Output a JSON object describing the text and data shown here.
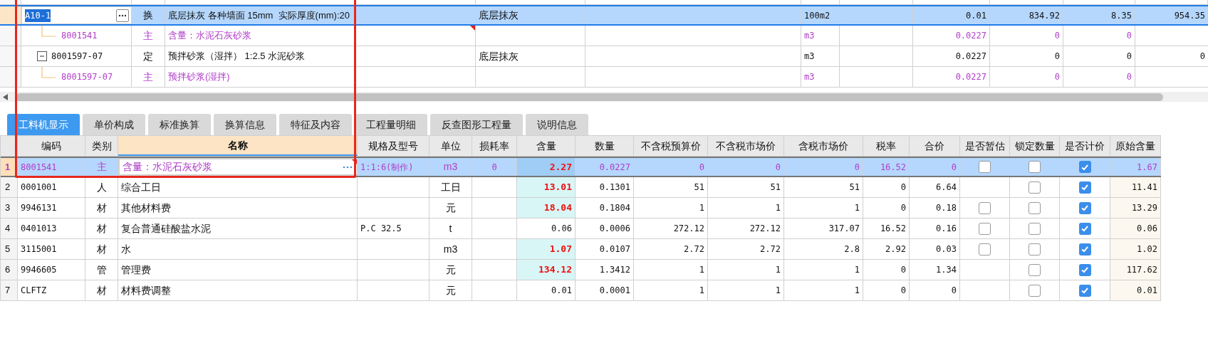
{
  "top_grid": {
    "rows": [
      {
        "code": "A10-1",
        "type": "换",
        "name": "底层抹灰 各种墙面 15mm  实际厚度(mm):20",
        "column_4": "底层抹灰",
        "unit": "100m2",
        "column_8": "0.01",
        "column_9": "834.92",
        "column_10": "8.35",
        "column_11": "954.35",
        "selected": true,
        "kind": "item",
        "editing": true,
        "children": [
          {
            "code": "8001541",
            "type": "主",
            "name": "含量：水泥石灰砂浆",
            "unit": "m3",
            "column_8": "0.0227",
            "column_9": "0",
            "column_10": "0",
            "selected": false,
            "kind": "resource",
            "flagged": true
          },
          {
            "code": "8001597-07",
            "type": "定",
            "name": "预拌砂浆（湿拌） 1:2.5 水泥砂浆",
            "column_4": "底层抹灰",
            "unit": "m3",
            "column_8": "0.0227",
            "column_9": "0",
            "column_10": "0",
            "column_11": "0",
            "selected": false,
            "kind": "item",
            "expanded": true,
            "children": [
              {
                "code": "8001597-07",
                "type": "主",
                "name": "预拌砂浆(湿拌)",
                "unit": "m3",
                "column_8": "0.0227",
                "column_9": "0",
                "column_10": "0",
                "selected": false,
                "kind": "resource"
              }
            ]
          }
        ]
      }
    ]
  },
  "tabs": [
    {
      "label": "工料机显示",
      "selected": true
    },
    {
      "label": "单价构成",
      "selected": false
    },
    {
      "label": "标准换算",
      "selected": false
    },
    {
      "label": "换算信息",
      "selected": false
    },
    {
      "label": "特征及内容",
      "selected": false
    },
    {
      "label": "工程量明细",
      "selected": false
    },
    {
      "label": "反查图形工程量",
      "selected": false
    },
    {
      "label": "说明信息",
      "selected": false
    }
  ],
  "detail_table": {
    "columns": [
      {
        "label": "编码",
        "selected": false
      },
      {
        "label": "类别",
        "selected": false
      },
      {
        "label": "名称",
        "selected": true
      },
      {
        "label": "规格及型号",
        "selected": false
      },
      {
        "label": "单位",
        "selected": false
      },
      {
        "label": "损耗率",
        "selected": false
      },
      {
        "label": "含量",
        "selected": false
      },
      {
        "label": "数量",
        "selected": false
      },
      {
        "label": "不含税预算价",
        "selected": false
      },
      {
        "label": "不含税市场价",
        "selected": false
      },
      {
        "label": "含税市场价",
        "selected": false
      },
      {
        "label": "税率",
        "selected": false
      },
      {
        "label": "合价",
        "selected": false
      },
      {
        "label": "是否暂估",
        "selected": false
      },
      {
        "label": "锁定数量",
        "selected": false
      },
      {
        "label": "是否计价",
        "selected": false
      },
      {
        "label": "原始含量",
        "selected": false
      }
    ],
    "rows": [
      {
        "number": "1",
        "code": "8001541",
        "type": "主",
        "name": "含量：水泥石灰砂浆",
        "spec": "1:1:6(制作)",
        "unit": "m3",
        "loss": "0",
        "content": "2.27",
        "quantity": "0.0227",
        "budget_price_ex_tax": "0",
        "market_price_ex_tax": "0",
        "market_price_inc_tax": "0",
        "tax_rate": "16.52",
        "total": "0",
        "provisional": false,
        "locked": false,
        "counted": true,
        "original_content": "1.67",
        "selected": true,
        "kind": "resource",
        "content_changed": true,
        "flagged": true,
        "editing": true
      },
      {
        "number": "2",
        "code": "0001001",
        "type": "人",
        "name": "综合工日",
        "unit": "工日",
        "content": "13.01",
        "quantity": "0.1301",
        "budget_price_ex_tax": "51",
        "market_price_ex_tax": "51",
        "market_price_inc_tax": "51",
        "tax_rate": "0",
        "total": "6.64",
        "locked": false,
        "counted": true,
        "original_content": "11.41",
        "selected": false,
        "kind": "normal",
        "content_changed": true
      },
      {
        "number": "3",
        "code": "9946131",
        "type": "材",
        "name": "其他材料费",
        "unit": "元",
        "content": "18.04",
        "quantity": "0.1804",
        "budget_price_ex_tax": "1",
        "market_price_ex_tax": "1",
        "market_price_inc_tax": "1",
        "tax_rate": "0",
        "total": "0.18",
        "provisional": false,
        "locked": false,
        "counted": true,
        "original_content": "13.29",
        "selected": false,
        "kind": "normal",
        "content_changed": true
      },
      {
        "number": "4",
        "code": "0401013",
        "type": "材",
        "name": "复合普通硅酸盐水泥",
        "spec": "P.C 32.5",
        "unit": "t",
        "content": "0.06",
        "quantity": "0.0006",
        "budget_price_ex_tax": "272.12",
        "market_price_ex_tax": "272.12",
        "market_price_inc_tax": "317.07",
        "tax_rate": "16.52",
        "total": "0.16",
        "provisional": false,
        "locked": false,
        "counted": true,
        "original_content": "0.06",
        "selected": false,
        "kind": "normal",
        "content_changed": false
      },
      {
        "number": "5",
        "code": "3115001",
        "type": "材",
        "name": "水",
        "unit": "m3",
        "content": "1.07",
        "quantity": "0.0107",
        "budget_price_ex_tax": "2.72",
        "market_price_ex_tax": "2.72",
        "market_price_inc_tax": "2.8",
        "tax_rate": "2.92",
        "total": "0.03",
        "provisional": false,
        "locked": false,
        "counted": true,
        "original_content": "1.02",
        "selected": false,
        "kind": "normal",
        "content_changed": true
      },
      {
        "number": "6",
        "code": "9946605",
        "type": "管",
        "name": "管理费",
        "unit": "元",
        "content": "134.12",
        "quantity": "1.3412",
        "budget_price_ex_tax": "1",
        "market_price_ex_tax": "1",
        "market_price_inc_tax": "1",
        "tax_rate": "0",
        "total": "1.34",
        "locked": false,
        "counted": true,
        "original_content": "117.62",
        "selected": false,
        "kind": "normal",
        "content_changed": true
      },
      {
        "number": "7",
        "code": "CLFTZ",
        "type": "材",
        "name": "材料费调整",
        "unit": "元",
        "content": "0.01",
        "quantity": "0.0001",
        "budget_price_ex_tax": "1",
        "market_price_ex_tax": "1",
        "market_price_inc_tax": "1",
        "tax_rate": "0",
        "total": "0",
        "locked": false,
        "counted": true,
        "original_content": "0.01",
        "selected": false,
        "kind": "normal",
        "content_changed": false
      }
    ]
  }
}
